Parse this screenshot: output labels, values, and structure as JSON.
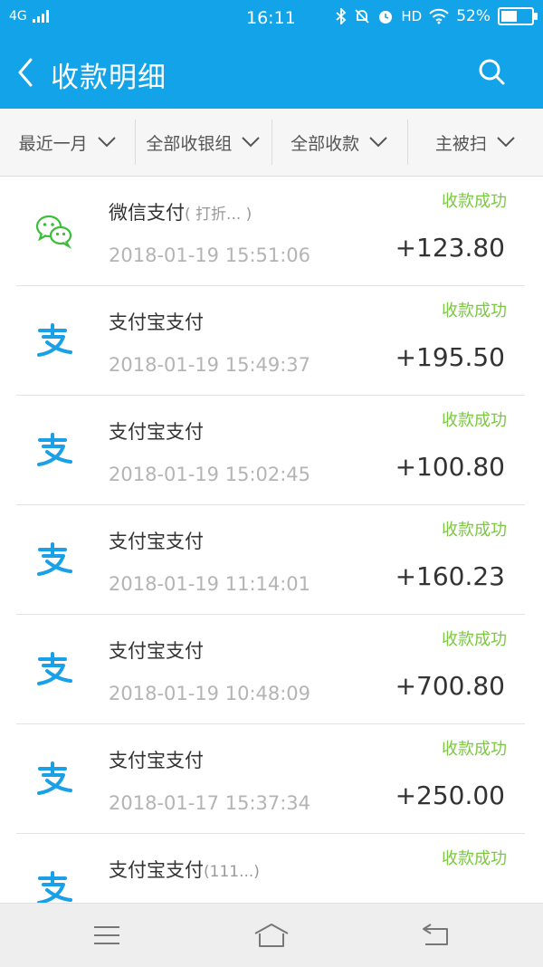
{
  "status_bar": {
    "network": "4G",
    "time": "16:11",
    "hd_label": "HD",
    "battery_text": "52%",
    "battery_level": 0.52
  },
  "header": {
    "title": "收款明细"
  },
  "filters": [
    {
      "label": "最近一月"
    },
    {
      "label": "全部收银组"
    },
    {
      "label": "全部收款"
    },
    {
      "label": "主被扫"
    }
  ],
  "transactions": [
    {
      "method": "微信支付",
      "note": "( 打折... )",
      "time": "2018-01-19 15:51:06",
      "status": "收款成功",
      "amount": "+123.80",
      "icon": "wechat-pay-icon"
    },
    {
      "method": "支付宝支付",
      "note": "",
      "time": "2018-01-19 15:49:37",
      "status": "收款成功",
      "amount": "+195.50",
      "icon": "alipay-icon"
    },
    {
      "method": "支付宝支付",
      "note": "",
      "time": "2018-01-19 15:02:45",
      "status": "收款成功",
      "amount": "+100.80",
      "icon": "alipay-icon"
    },
    {
      "method": "支付宝支付",
      "note": "",
      "time": "2018-01-19 11:14:01",
      "status": "收款成功",
      "amount": "+160.23",
      "icon": "alipay-icon"
    },
    {
      "method": "支付宝支付",
      "note": "",
      "time": "2018-01-19 10:48:09",
      "status": "收款成功",
      "amount": "+700.80",
      "icon": "alipay-icon"
    },
    {
      "method": "支付宝支付",
      "note": "",
      "time": "2018-01-17 15:37:34",
      "status": "收款成功",
      "amount": "+250.00",
      "icon": "alipay-icon"
    },
    {
      "method": "支付宝支付",
      "note": "(111...)",
      "time": "",
      "status": "收款成功",
      "amount": "",
      "icon": "alipay-icon"
    }
  ],
  "colors": {
    "brand_blue": "#12a3e8",
    "success_green": "#7cc842",
    "wechat_green": "#3bbf3a",
    "alipay_blue": "#1aa0e6"
  }
}
